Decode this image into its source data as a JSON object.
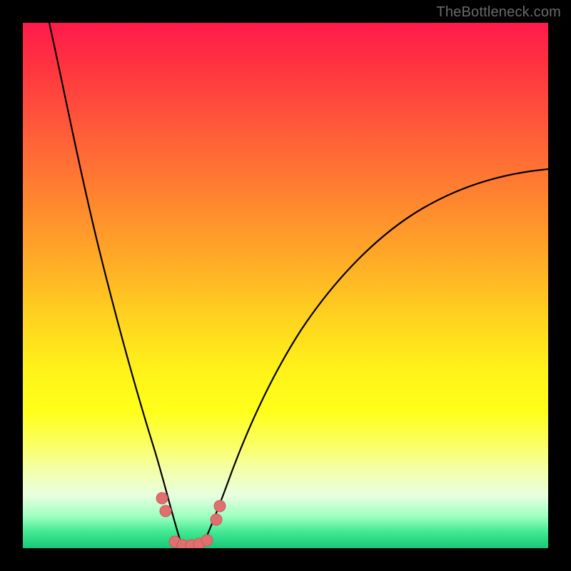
{
  "watermark": "TheBottleneck.com",
  "colors": {
    "gradient_top": "#ff1a4d",
    "gradient_mid": "#fff21a",
    "gradient_bottom": "#18c878",
    "curve": "#000000",
    "marker_fill": "#e07070",
    "marker_stroke": "#c85a5a",
    "frame": "#000000"
  },
  "chart_data": {
    "type": "line",
    "title": "",
    "xlabel": "",
    "ylabel": "",
    "xlim": [
      0,
      100
    ],
    "ylim": [
      0,
      100
    ],
    "grid": false,
    "legend": false,
    "series": [
      {
        "name": "left-branch",
        "x": [
          5,
          8,
          12,
          16,
          20,
          23,
          26,
          27.5,
          29,
          30.5
        ],
        "values": [
          100,
          84,
          64,
          46,
          30,
          18,
          8,
          3.5,
          1,
          0
        ]
      },
      {
        "name": "right-branch",
        "x": [
          34,
          36,
          38,
          41,
          45,
          50,
          56,
          63,
          71,
          80,
          90,
          100
        ],
        "values": [
          0,
          2,
          6,
          13,
          22,
          32,
          42,
          51,
          58.5,
          64,
          68.5,
          72
        ]
      }
    ],
    "markers": [
      {
        "x": 26.5,
        "y": 9.5
      },
      {
        "x": 27.2,
        "y": 7.0
      },
      {
        "x": 29.0,
        "y": 1.2
      },
      {
        "x": 30.5,
        "y": 0.5
      },
      {
        "x": 32.0,
        "y": 0.5
      },
      {
        "x": 33.5,
        "y": 0.8
      },
      {
        "x": 35.0,
        "y": 1.5
      },
      {
        "x": 36.8,
        "y": 5.5
      },
      {
        "x": 37.5,
        "y": 8.0
      }
    ],
    "annotations": []
  }
}
